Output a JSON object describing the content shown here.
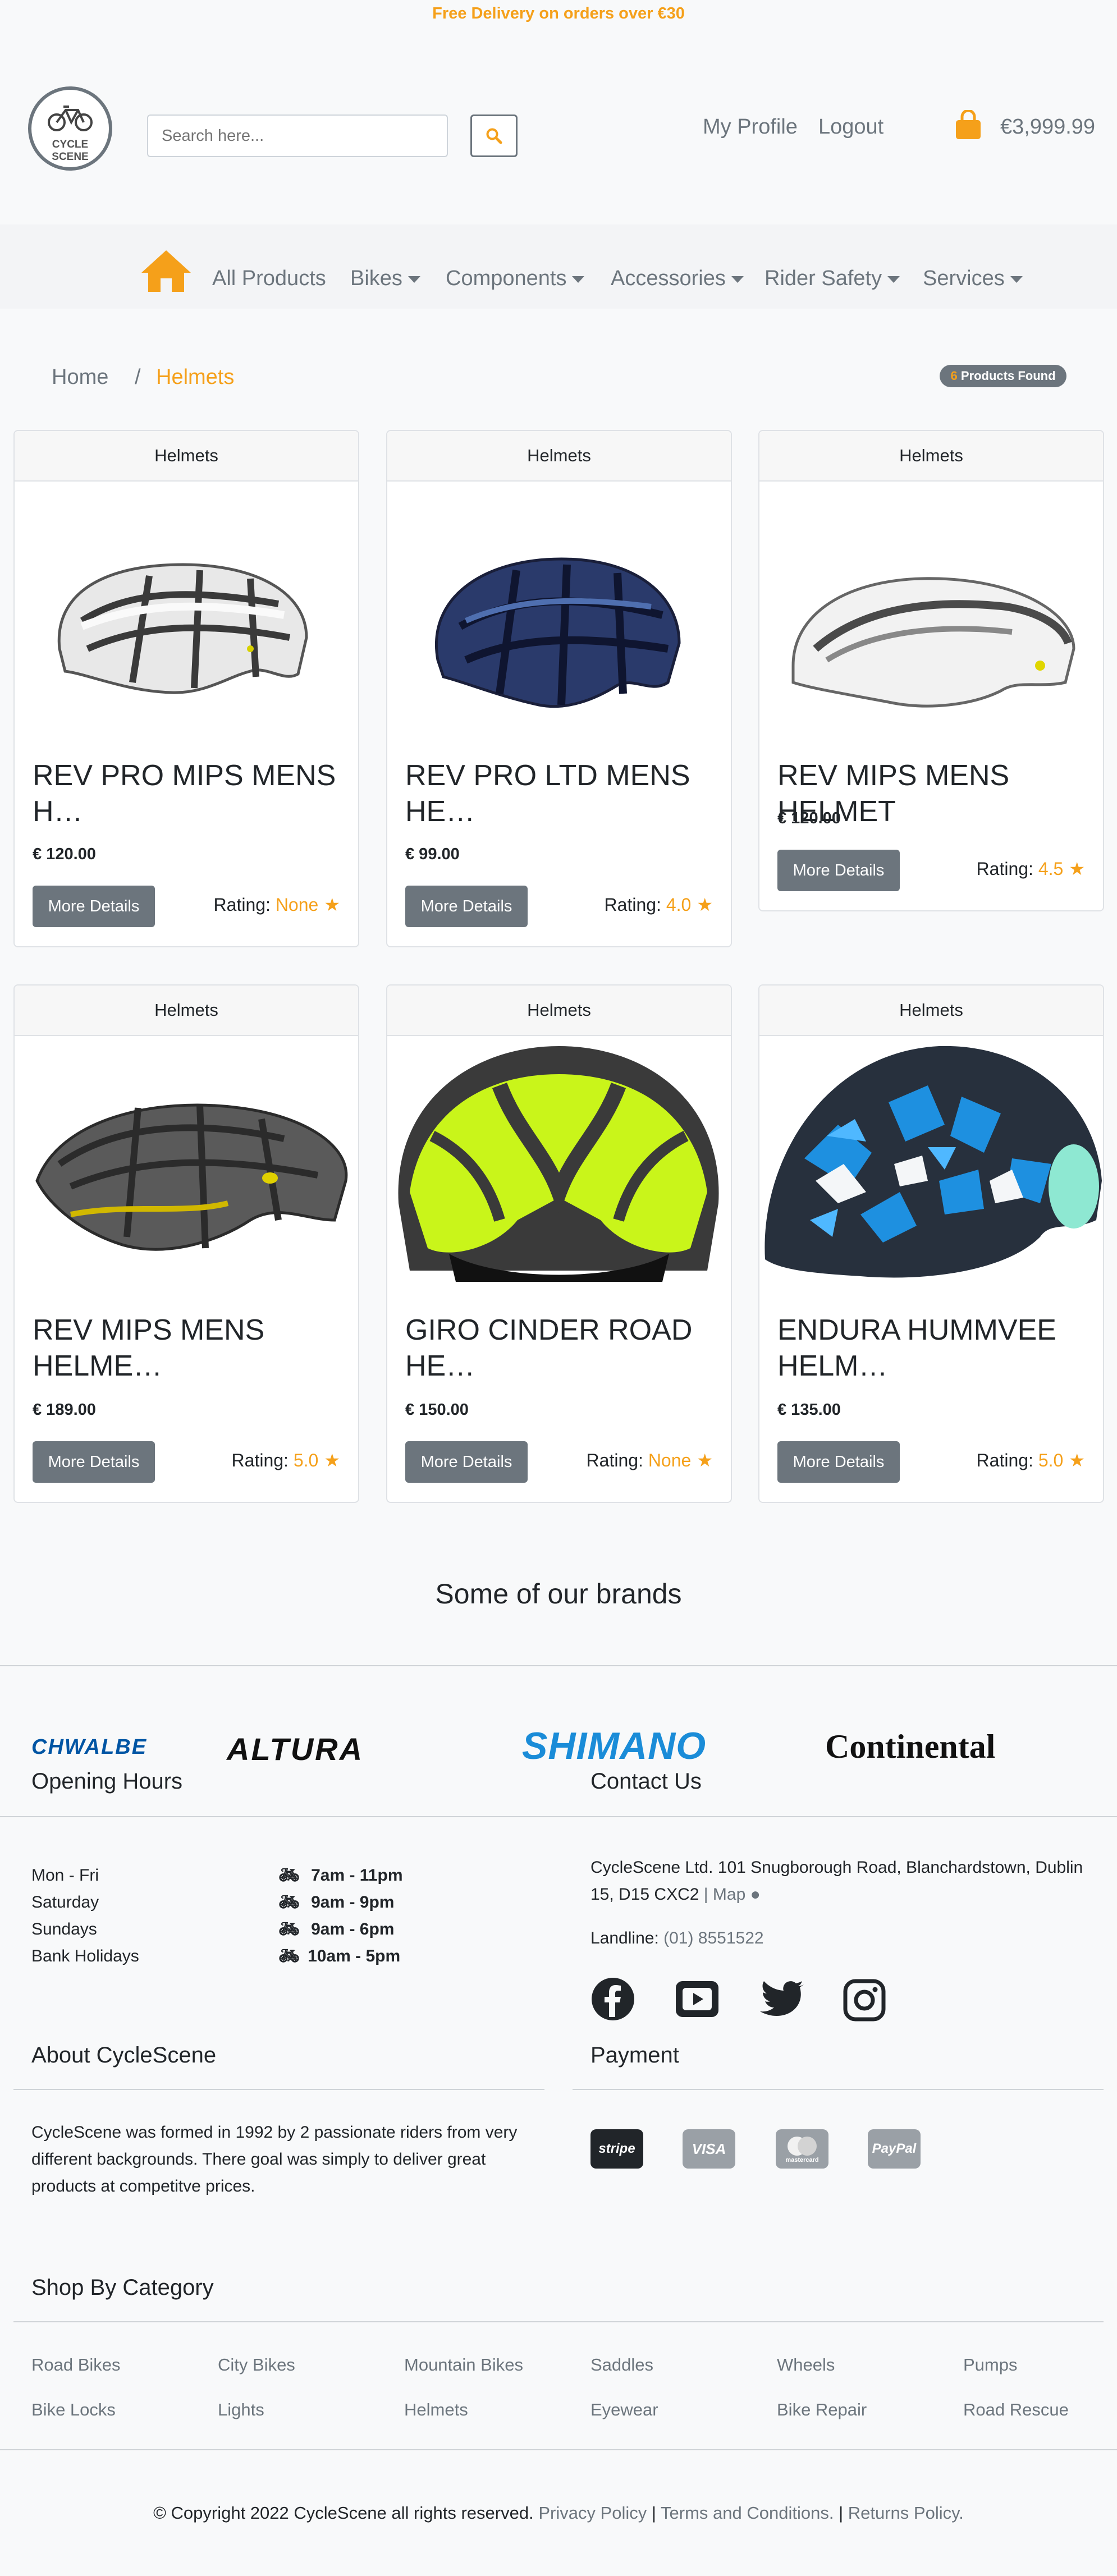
{
  "promo": "Free Delivery on orders over €30",
  "logo": {
    "line1": "CYCLE",
    "line2": "SCENE"
  },
  "search": {
    "placeholder": "Search here..."
  },
  "header": {
    "profile": "My Profile",
    "logout": "Logout",
    "cart_total": "€3,999.99"
  },
  "nav": {
    "all_products": "All Products",
    "bikes": "Bikes",
    "components": "Components",
    "accessories": "Accessories",
    "rider_safety": "Rider Safety",
    "services": "Services"
  },
  "breadcrumb": {
    "home": "Home",
    "separator": "/",
    "current": "Helmets"
  },
  "products_found": {
    "count": "6",
    "label": "Products Found"
  },
  "products": [
    {
      "category": "Helmets",
      "title": "REV PRO MIPS MENS H…",
      "price": "€ 120.00",
      "button": "More Details",
      "rating_label": "Rating:",
      "rating": "None"
    },
    {
      "category": "Helmets",
      "title": "REV PRO LTD MENS HE…",
      "price": "€ 99.00",
      "button": "More Details",
      "rating_label": "Rating:",
      "rating": "4.0"
    },
    {
      "category": "Helmets",
      "title": "REV MIPS MENS HELMET",
      "price": "€ 120.00",
      "button": "More Details",
      "rating_label": "Rating:",
      "rating": "4.5"
    },
    {
      "category": "Helmets",
      "title": "REV MIPS MENS HELME…",
      "price": "€ 189.00",
      "button": "More Details",
      "rating_label": "Rating:",
      "rating": "5.0"
    },
    {
      "category": "Helmets",
      "title": "GIRO CINDER ROAD HE…",
      "price": "€ 150.00",
      "button": "More Details",
      "rating_label": "Rating:",
      "rating": "None"
    },
    {
      "category": "Helmets",
      "title": "ENDURA HUMMVEE HELM…",
      "price": "€ 135.00",
      "button": "More Details",
      "rating_label": "Rating:",
      "rating": "5.0"
    }
  ],
  "brands": {
    "title": "Some of our brands",
    "items": [
      "CHWALBE",
      "ALTURA",
      "SHIMANO",
      "Continental"
    ]
  },
  "opening_hours": {
    "title": "Opening Hours",
    "rows": [
      {
        "day": "Mon - Fri",
        "time": "7am - 11pm"
      },
      {
        "day": "Saturday",
        "time": "9am - 9pm"
      },
      {
        "day": "Sundays",
        "time": "9am - 6pm"
      },
      {
        "day": "Bank Holidays",
        "time": "10am - 5pm"
      }
    ]
  },
  "contact": {
    "title": "Contact Us",
    "address_line1": "CycleScene Ltd. 101 Snugborough Road, Blanchardstown, Dublin",
    "address_line2": "15, D15 CXC2",
    "map_sep": "|",
    "map": "Map",
    "landline_label": "Landline:",
    "landline": "(01) 8551522"
  },
  "about": {
    "title": "About CycleScene",
    "lines": [
      "CycleScene was formed in 1992 by 2 passionate riders from very",
      "different backgrounds. There goal was simply to deliver great",
      "products at competitve prices."
    ]
  },
  "payment": {
    "title": "Payment",
    "methods": [
      "stripe",
      "VISA",
      "mastercard",
      "PayPal"
    ]
  },
  "shop_by_category": {
    "title": "Shop By Category",
    "items": [
      "Road Bikes",
      "City Bikes",
      "Mountain Bikes",
      "Saddles",
      "Wheels",
      "Pumps",
      "Bike Locks",
      "Lights",
      "Helmets",
      "Eyewear",
      "Bike Repair",
      "Road Rescue"
    ]
  },
  "footer": {
    "copyright": "© Copyright 2022 CycleScene all rights reserved.",
    "privacy": "Privacy Policy",
    "sep": "|",
    "terms": "Terms and Conditions.",
    "returns": "Returns Policy."
  },
  "colors": {
    "accent": "#f5a01a",
    "muted": "#6c757d",
    "shimano": "#1a8cd8",
    "schwalbe": "#0055a4"
  }
}
